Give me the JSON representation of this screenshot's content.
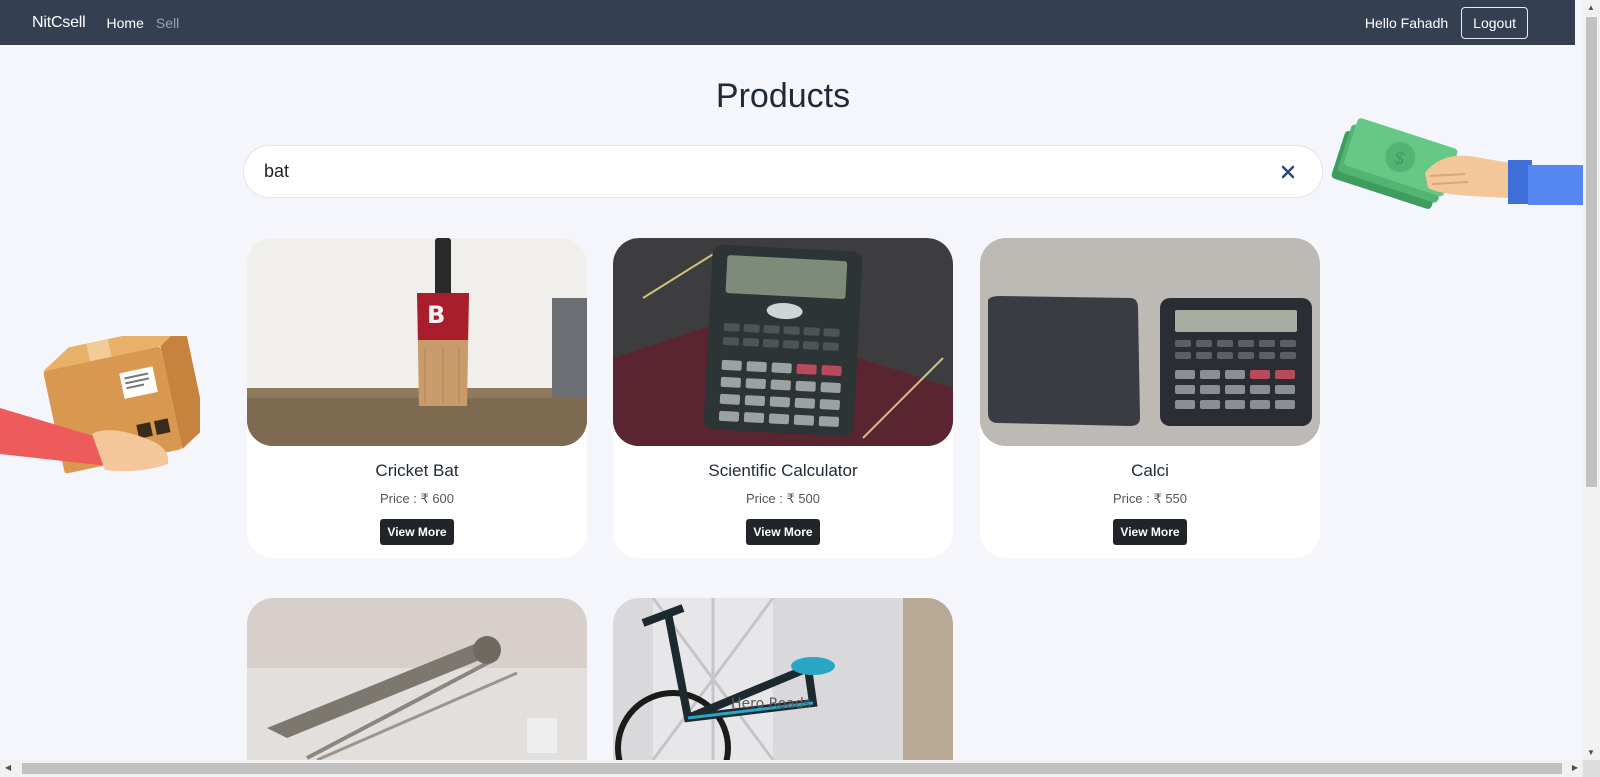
{
  "navbar": {
    "brand": "NitCsell",
    "links": [
      "Home",
      "Sell"
    ],
    "greeting": "Hello Fahadh",
    "logout_label": "Logout"
  },
  "page": {
    "title": "Products"
  },
  "search": {
    "value": "bat",
    "clear_icon": "close-icon"
  },
  "products": [
    {
      "name": "Cricket Bat",
      "price": "Price : ₹ 600",
      "button": "View More",
      "image": "cricket-bat-photo"
    },
    {
      "name": "Scientific Calculator",
      "price": "Price : ₹ 500",
      "button": "View More",
      "image": "calculator-photo"
    },
    {
      "name": "Calci",
      "price": "Price : ₹ 550",
      "button": "View More",
      "image": "calculator-with-case-photo"
    },
    {
      "image": "metal-tool-photo"
    },
    {
      "image": "bicycle-photo",
      "watermark": "Hero Roads"
    }
  ],
  "colors": {
    "navbar": "#343f52",
    "background": "#f5f6fc",
    "button": "#212529",
    "clear_icon": "#2f4a7a"
  }
}
